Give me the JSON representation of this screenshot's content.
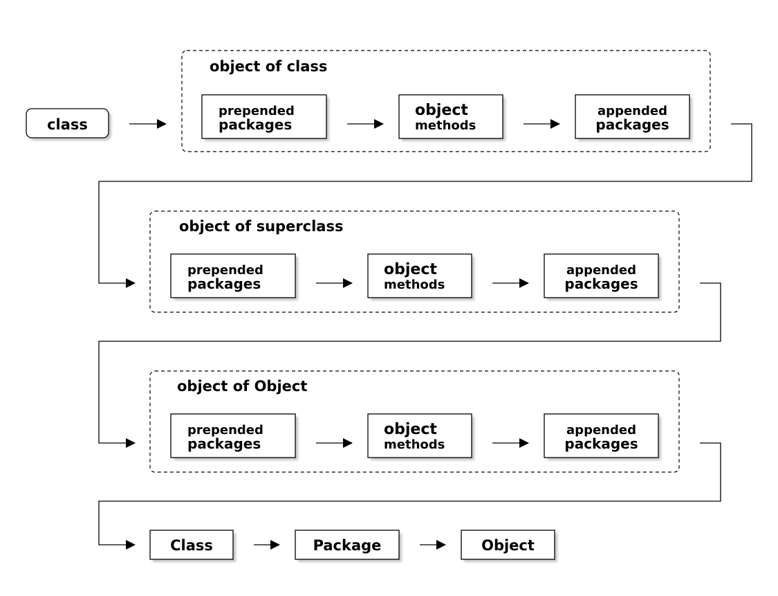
{
  "start": {
    "label": "class"
  },
  "groups": [
    {
      "title": "object of class",
      "boxes": [
        {
          "line1": "prepended",
          "line2": "packages"
        },
        {
          "line1": "object",
          "line2": "methods"
        },
        {
          "line1": "appended",
          "line2": "packages"
        }
      ]
    },
    {
      "title": "object of superclass",
      "boxes": [
        {
          "line1": "prepended",
          "line2": "packages"
        },
        {
          "line1": "object",
          "line2": "methods"
        },
        {
          "line1": "appended",
          "line2": "packages"
        }
      ]
    },
    {
      "title": "object of Object",
      "boxes": [
        {
          "line1": "prepended",
          "line2": "packages"
        },
        {
          "line1": "object",
          "line2": "methods"
        },
        {
          "line1": "appended",
          "line2": "packages"
        }
      ]
    }
  ],
  "final": [
    {
      "label": "Class"
    },
    {
      "label": "Package"
    },
    {
      "label": "Object"
    }
  ]
}
